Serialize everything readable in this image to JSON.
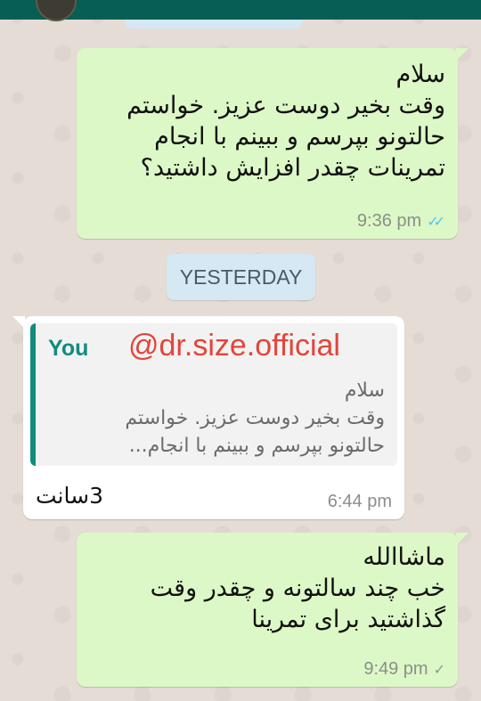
{
  "theme": {
    "header_bg": "#075e54",
    "chat_bg": "#e5ddd5",
    "outgoing_bg": "#dcf8c6",
    "incoming_bg": "#ffffff",
    "read_tick_color": "#4fc3f7",
    "quote_accent": "#128c7e",
    "watermark_color": "#e2453a"
  },
  "messages": [
    {
      "direction": "outgoing",
      "text": "سلام\nوقت بخیر دوست عزیز. خواستم\nحالتونو بپرسم و ببینم با انجام\nتمرینات چقدر افزایش داشتید؟",
      "time": "9:36 pm",
      "status": "read"
    },
    {
      "direction": "incoming",
      "quote_author": "You",
      "quote_text": "سلام\nوقت بخیر دوست عزیز. خواستم\nحالتونو بپرسم و ببینم با انجام...",
      "text": "3سانت",
      "time": "6:44 pm"
    },
    {
      "direction": "outgoing",
      "text": "ماشاالله\nخب چند سالتونه و چقدر وقت\nگذاشتید برای تمرینا",
      "time": "9:49 pm",
      "status": "sent"
    }
  ],
  "date_separator": "YESTERDAY",
  "watermark": "@dr.size.official",
  "icons": {
    "read": "double-check-icon",
    "sent": "single-check-icon"
  }
}
